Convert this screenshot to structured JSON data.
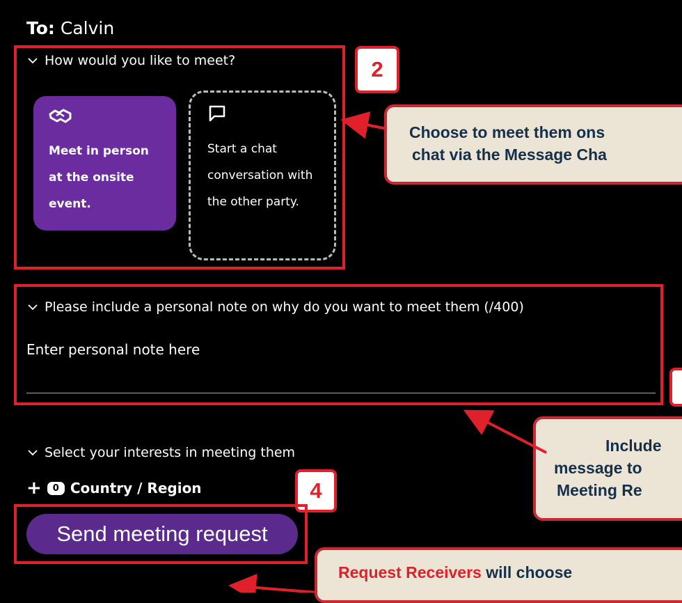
{
  "recipient": {
    "label": "To:",
    "name": "Calvin"
  },
  "meet_section": {
    "header": "How would you like to meet?",
    "options": [
      {
        "label": "Meet in person at the onsite event.",
        "icon": "handshake-icon"
      },
      {
        "label": "Start a chat conversation with the other party.",
        "icon": "chat-bubble-icon"
      }
    ]
  },
  "note_section": {
    "header": "Please include a personal note on why do you want to meet them (/400)",
    "placeholder": "Enter personal note here"
  },
  "interests_section": {
    "header": "Select your interests in meeting them",
    "count": "0",
    "item_label": "Country / Region"
  },
  "send_button": {
    "label": "Send meeting request"
  },
  "annotations": {
    "badge_2": "2",
    "badge_4": "4",
    "callout_meet_line1": "Choose to meet them ons",
    "callout_meet_line2": "chat via the Message Cha",
    "callout_note_line1": "Include",
    "callout_note_line2": "message to",
    "callout_note_line3": "Meeting Re",
    "callout_request_highlight": "Request Receivers",
    "callout_request_rest": "will choose"
  },
  "colors": {
    "background": "#000000",
    "accent_purple": "#6b2c9f",
    "button_purple": "#5b2a8d",
    "annotation_red": "#e0202a",
    "callout_bg": "#ece4d5",
    "callout_text": "#14304b"
  }
}
